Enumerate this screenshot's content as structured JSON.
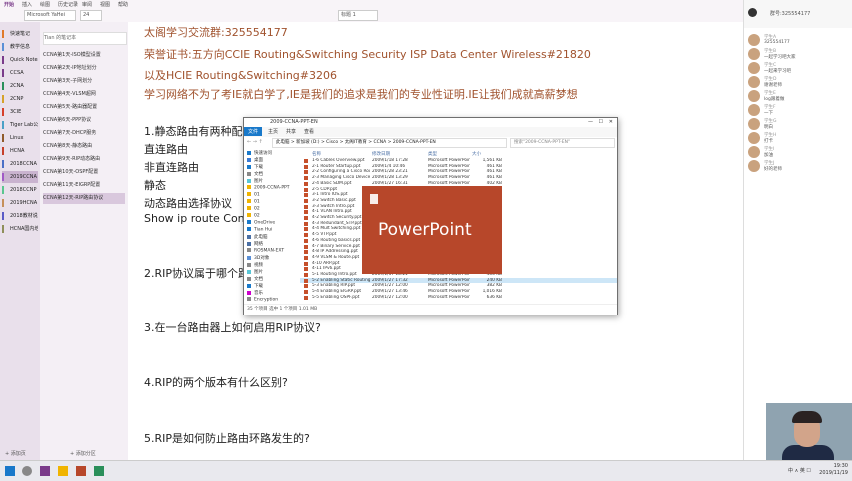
{
  "ribbon": {
    "tabs": [
      "开始",
      "插入",
      "绘图",
      "历史记录",
      "审阅",
      "视图",
      "帮助"
    ],
    "font_name": "Microsoft YaHei",
    "font_size": "24",
    "style_box": "标题 1"
  },
  "notebooks": [
    {
      "label": "快速笔记",
      "color": "#e07a2a"
    },
    {
      "label": "教学信息",
      "color": "#5a8fd6"
    },
    {
      "label": "Quick Notes",
      "color": "#7a3b8a"
    },
    {
      "label": "CCSA",
      "color": "#7a3b8a"
    },
    {
      "label": "2CNA",
      "color": "#2a8f5a"
    },
    {
      "label": "2CNP",
      "color": "#d6a22a"
    },
    {
      "label": "3CIE",
      "color": "#d6402a"
    },
    {
      "label": "Tiger Lab公开课",
      "color": "#4aa0c6"
    },
    {
      "label": "Linux",
      "color": "#8f5a2a"
    },
    {
      "label": "HCNA",
      "color": "#c6402a"
    },
    {
      "label": "2018CCNA",
      "color": "#4a6fc6"
    },
    {
      "label": "2019CCNA",
      "color": "#a05ac6"
    },
    {
      "label": "2018CCNP",
      "color": "#5ac68f"
    },
    {
      "label": "2019HCNA",
      "color": "#c68f5a"
    },
    {
      "label": "2018教材说明",
      "color": "#5a5ac6"
    },
    {
      "label": "HCNA国内培训",
      "color": "#8f8f5a"
    }
  ],
  "sections": {
    "search_placeholder": "Tian 的笔记本",
    "items": [
      "CCNA第1天-ISO模型设置",
      "CCNA第2天-IP地址划分",
      "CCNA第3天-子网划分",
      "CCNA第4天-VLSM超网",
      "CCNA第5天-路由器配置",
      "CCNA第6天-PPP协议",
      "CCNA第7天-DHCP服务",
      "CCNA第8天-静态路由",
      "CCNA第9天-RIP动态路由",
      "CCNA第10天-OSPF配置",
      "CCNA第11天-EIGRP配置",
      "CCNA第12天-RIP路由协议"
    ]
  },
  "notes": {
    "line1": "太阁学习交流群:325554177",
    "line2": "荣誉证书:五方向CCIE Routing&Switching Security ISP Data Center Wireless#21820",
    "line3": "以及HCIE Routing&Switching#3206",
    "line4": "学习网络不为了考IE就白学了,IE是我们的追求是我们的专业性证明.IE让我们成就高薪梦想",
    "q1": "1.静态路由有两种配置",
    "q1a": "直连路由",
    "q1b": "非直连路由",
    "q1c": "静态",
    "q1d": "动态路由选择协议",
    "q1e": "Show ip route   Con",
    "q2": "2.RIP协议属于哪个路",
    "q3": "3.在一台路由器上如何启用RIP协议?",
    "q4": "4.RIP的两个版本有什么区别?",
    "q5": "5.RIP是如何防止路由环路发生的?"
  },
  "explorer": {
    "title": "2009-CCNA-PPT-EN",
    "tabs": [
      "文件",
      "主页",
      "共享",
      "查看"
    ],
    "address": "此电脑 > 新加坡 (D:) > Cisco > 太阁IT教育 > CCNA > 2009-CCNA-PPT-EN",
    "search_placeholder": "搜索\"2009-CCNA-PPT-EN\"",
    "nav": [
      "快速访问",
      "桌面",
      "下载",
      "文档",
      "图片",
      "2009-CCNA-PPT",
      "01",
      "01",
      "02",
      "02",
      "OneDrive",
      "Tian Hui",
      "此电脑",
      "网络",
      "ROSMAN-EXT",
      "3D对象",
      "视频",
      "图片",
      "文档",
      "下载",
      "音乐",
      "Encryption"
    ],
    "columns": [
      "名称",
      "修改日期",
      "类型",
      "大小"
    ],
    "files": [
      {
        "name": "1-6 Cables Overview.ppt",
        "date": "2009/1/18 17:28",
        "type": "Microsoft PowerPoint",
        "size": "1,561 KB"
      },
      {
        "name": "2-1 Router Startup.ppt",
        "date": "2009/1/4 10:46",
        "type": "Microsoft PowerPoint",
        "size": "461 KB"
      },
      {
        "name": "2-2 Configuring a Cisco Router.ppt",
        "date": "2009/1/28 23:21",
        "type": "Microsoft PowerPoint",
        "size": "461 KB"
      },
      {
        "name": "2-3 Managing Cisco Devices.ppt",
        "date": "2009/1/28 13:29",
        "type": "Microsoft PowerPoint",
        "size": "461 KB"
      },
      {
        "name": "2-4 Basic SDM.ppt",
        "date": "2009/1/27 16:31",
        "type": "Microsoft PowerPoint",
        "size": "402 KB"
      },
      {
        "name": "2-5 CDP.ppt",
        "date": "2009/1/20 15:56",
        "type": "Microsoft PowerPoint",
        "size": "178 KB"
      },
      {
        "name": "3-1 Intro IOS.ppt",
        "date": "",
        "type": "",
        "size": ""
      },
      {
        "name": "3-2 Switch Basic.ppt",
        "date": "",
        "type": "",
        "size": ""
      },
      {
        "name": "3-3 Switch Intro.ppt",
        "date": "",
        "type": "",
        "size": ""
      },
      {
        "name": "4-1 VLAN Intro.ppt",
        "date": "",
        "type": "",
        "size": ""
      },
      {
        "name": "4-2 Switch Security.ppt",
        "date": "",
        "type": "",
        "size": ""
      },
      {
        "name": "4-3 Redundant_STP.ppt",
        "date": "",
        "type": "",
        "size": ""
      },
      {
        "name": "4-4 Mult Switching.ppt",
        "date": "",
        "type": "",
        "size": ""
      },
      {
        "name": "4-5 VTP.ppt",
        "date": "",
        "type": "",
        "size": ""
      },
      {
        "name": "4-6 Routing basics.ppt",
        "date": "",
        "type": "",
        "size": ""
      },
      {
        "name": "4-7 Binary Service.ppt",
        "date": "",
        "type": "",
        "size": ""
      },
      {
        "name": "4-8 IP Addressing.ppt",
        "date": "",
        "type": "",
        "size": ""
      },
      {
        "name": "4-9 VLSM & Route.ppt",
        "date": "",
        "type": "",
        "size": ""
      },
      {
        "name": "4-10 ARP.ppt",
        "date": "",
        "type": "",
        "size": ""
      },
      {
        "name": "4-11 IPv6.ppt",
        "date": "",
        "type": "",
        "size": ""
      },
      {
        "name": "5-1 Routing Intro.ppt",
        "date": "2009/1/17 18:21",
        "type": "Microsoft PowerPoint",
        "size": "453 KB"
      },
      {
        "name": "5-2 Enabling Static Routing.ppt",
        "date": "2009/1/27 17:32",
        "type": "Microsoft PowerPoint",
        "size": "240 KB"
      },
      {
        "name": "5-3 Enabling RIP.ppt",
        "date": "2009/1/27 12:00",
        "type": "Microsoft PowerPoint",
        "size": "382 KB"
      },
      {
        "name": "5-4 Enabling EIGRP.ppt",
        "date": "2009/1/27 13:46",
        "type": "Microsoft PowerPoint",
        "size": "1,016 KB"
      },
      {
        "name": "5-5 Enabling OSPF.ppt",
        "date": "2009/1/27 12:00",
        "type": "Microsoft PowerPoint",
        "size": "636 KB"
      }
    ],
    "selected_index": 21,
    "status": "35 个项目    选中 1 个项目  1.01 MB"
  },
  "splash": {
    "app_name": "PowerPoint",
    "color": "#b7472a"
  },
  "chat": {
    "group": "群号:325554177",
    "messages": [
      {
        "user": "学生A",
        "text": "325554177"
      },
      {
        "user": "学生B",
        "text": "一起学习吧大家"
      },
      {
        "user": "学生C",
        "text": "一起来学习吧"
      },
      {
        "user": "学生D",
        "text": "谢谢老师"
      },
      {
        "user": "学生E",
        "text": "log跟着做"
      },
      {
        "user": "学生F",
        "text": "一下"
      },
      {
        "user": "学生G",
        "text": "明白"
      },
      {
        "user": "学生H",
        "text": "打卡"
      },
      {
        "user": "学生I",
        "text": "加油"
      },
      {
        "user": "学生J",
        "text": "好的老师"
      }
    ]
  },
  "footer": {
    "add_page": "+ 添加页",
    "add_section": "+ 添加分区"
  },
  "taskbar": {
    "tray": "中 ∧ 英 ☐",
    "time": "19:30",
    "date": "2019/11/19"
  }
}
